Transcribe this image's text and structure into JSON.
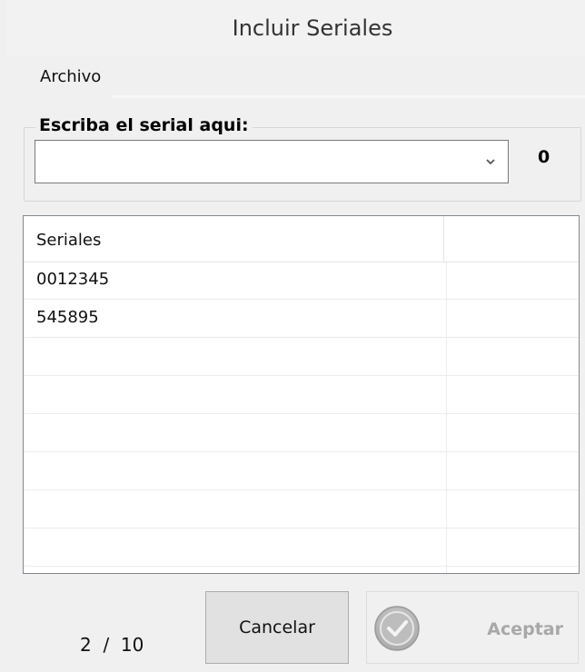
{
  "window": {
    "title": "Incluir Seriales"
  },
  "menu": {
    "items": [
      {
        "label": "Archivo"
      }
    ]
  },
  "serial_group": {
    "legend": "Escriba el serial aqui:",
    "input_value": "",
    "count": "0"
  },
  "list": {
    "columns": [
      "Seriales",
      ""
    ],
    "rows": [
      {
        "serial": "0012345"
      },
      {
        "serial": "545895"
      }
    ]
  },
  "footer": {
    "counter": "2  /  10",
    "cancel_label": "Cancelar",
    "accept_label": "Aceptar",
    "accept_enabled": false
  },
  "colors": {
    "window_bg": "#f0f0f0",
    "disabled_text": "#a8a8a8",
    "button_bg": "#e1e1e1"
  },
  "icons": {
    "combo_arrow": "chevron-down-icon",
    "accept": "check-circle-icon"
  }
}
